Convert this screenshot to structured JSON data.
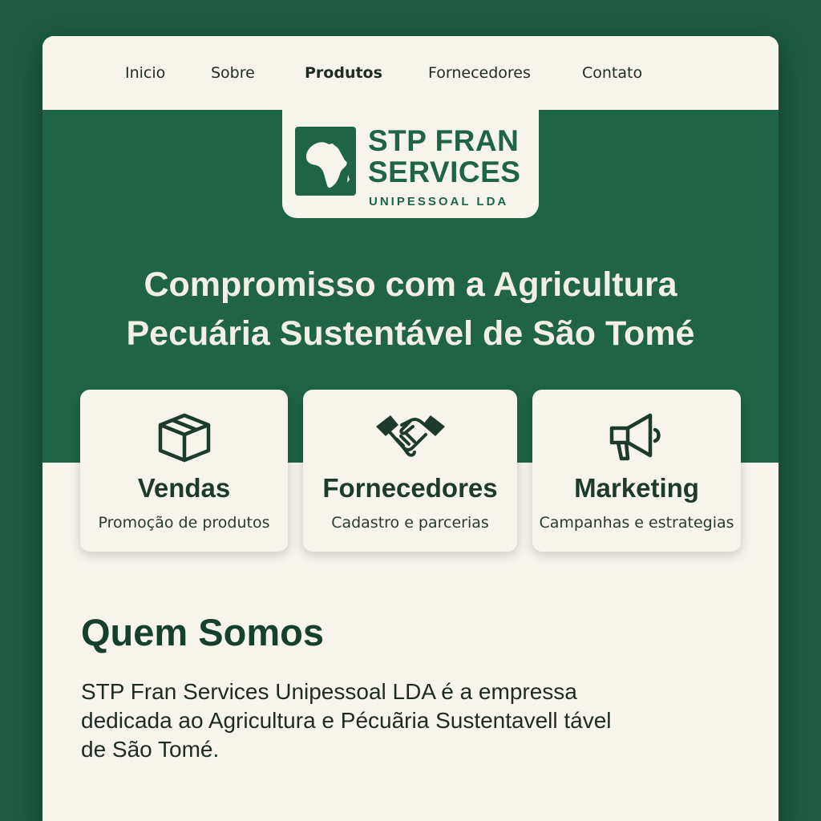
{
  "nav": {
    "items": [
      {
        "label": "Inicio"
      },
      {
        "label": "Sobre"
      },
      {
        "label": "Produtos"
      },
      {
        "label": "Fornecedores"
      },
      {
        "label": "Contato"
      }
    ]
  },
  "logo": {
    "line1": "STP FRAN",
    "line2": "SERVICES",
    "line3": "UNIPESSOAL LDA",
    "icon": "africa-map-icon"
  },
  "hero": {
    "title": "Compromisso com a Agricultura\nPecuária Sustentável de São Tomé"
  },
  "cards": [
    {
      "icon": "box-icon",
      "title": "Vendas",
      "subtitle": "Promoção de produtos"
    },
    {
      "icon": "handshake-icon",
      "title": "Fornecedores",
      "subtitle": "Cadastro e parcerias"
    },
    {
      "icon": "megaphone-icon",
      "title": "Marketing",
      "subtitle": "Campanhas e estrategias"
    }
  ],
  "about": {
    "title": "Quem Somos",
    "text": "STP Fran Services Unipessoal LDA é a empressa\ndedicada ao Agricultura e Pécuãria Sustentavell tável\nde São Tomé."
  },
  "colors": {
    "brand_green": "#1f6446",
    "outer_green": "#1e5b42",
    "cream": "#f7f4ec"
  }
}
